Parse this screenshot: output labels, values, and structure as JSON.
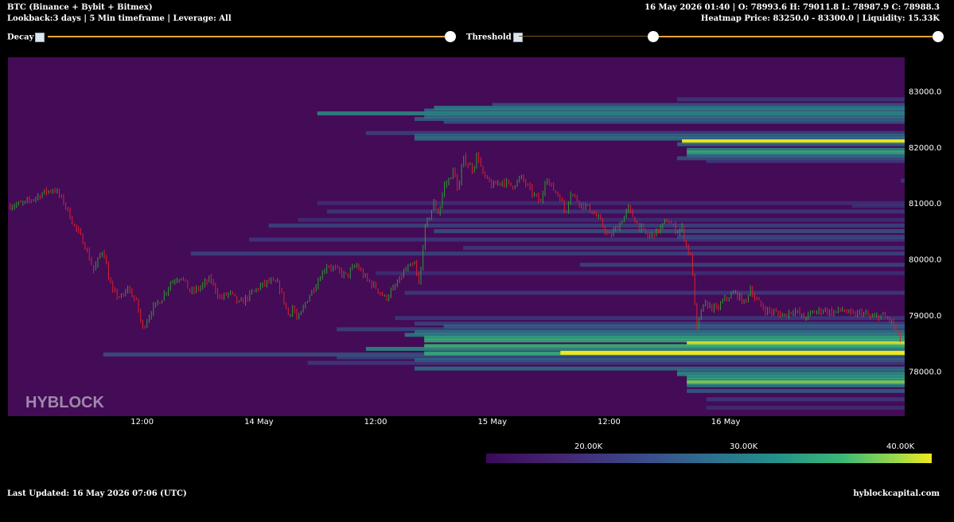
{
  "header": {
    "title": "BTC (Binance + Bybit + Bitmex)",
    "lookback": "Lookback:3 days | 5 Min timeframe | Leverage: All",
    "ohlc": "16 May 2026 01:40 | O: 78993.6 H: 79011.8 L: 78987.9 C: 78988.3",
    "heatmap_price": "Heatmap Price: 83250.0 - 83300.0 | Liquidity: 15.33K"
  },
  "controls": {
    "decay_label": "Decay",
    "threshold_label": "Threshold",
    "accent": "#e8a33d",
    "decay_value": 1.0,
    "threshold_range": [
      0.32,
      1.0
    ]
  },
  "footer": {
    "last_updated": "Last Updated: 16 May 2026 07:06 (UTC)",
    "site": "hyblockcapital.com"
  },
  "chart_data": {
    "type": "heatmap",
    "watermark": "HYBLOCK",
    "background": "#440b57",
    "y_ticks": [
      "83000.0",
      "82000.0",
      "81000.0",
      "80000.0",
      "79000.0",
      "78000.0"
    ],
    "ylim": [
      77200,
      83600
    ],
    "x_tick_labels": [
      "12:00",
      "14 May",
      "12:00",
      "15 May",
      "12:00",
      "16 May"
    ],
    "x_ticks_hours": [
      12,
      24,
      36,
      48,
      60,
      72
    ],
    "xlim_hours": [
      -1.8,
      90.4
    ],
    "colorbar": {
      "labels": [
        "20.00K",
        "30.00K",
        "40.00K"
      ],
      "colors": [
        "#3a0a5a",
        "#3b4a8a",
        "#24908a",
        "#3bb876",
        "#f0e81e"
      ]
    },
    "price_path": [
      [
        -1.8,
        80950
      ],
      [
        0,
        81000
      ],
      [
        2,
        81200
      ],
      [
        3,
        81250
      ],
      [
        4,
        81000
      ],
      [
        5,
        80600
      ],
      [
        6,
        80300
      ],
      [
        7,
        79800
      ],
      [
        8,
        80200
      ],
      [
        8.5,
        79700
      ],
      [
        9,
        79400
      ],
      [
        10,
        79300
      ],
      [
        10.5,
        79500
      ],
      [
        11.5,
        79200
      ],
      [
        12,
        78750
      ],
      [
        13,
        79100
      ],
      [
        14,
        79300
      ],
      [
        15,
        79600
      ],
      [
        16,
        79700
      ],
      [
        17,
        79400
      ],
      [
        18,
        79500
      ],
      [
        19,
        79650
      ],
      [
        20,
        79300
      ],
      [
        21,
        79400
      ],
      [
        22,
        79200
      ],
      [
        23,
        79350
      ],
      [
        24,
        79500
      ],
      [
        25,
        79600
      ],
      [
        26,
        79550
      ],
      [
        26.5,
        79300
      ],
      [
        27,
        79000
      ],
      [
        27.5,
        79150
      ],
      [
        28,
        78900
      ],
      [
        29,
        79300
      ],
      [
        30,
        79600
      ],
      [
        31,
        79900
      ],
      [
        32,
        79800
      ],
      [
        33,
        79700
      ],
      [
        34,
        79900
      ],
      [
        35,
        79650
      ],
      [
        36,
        79500
      ],
      [
        37,
        79300
      ],
      [
        38,
        79500
      ],
      [
        39,
        79800
      ],
      [
        40,
        79900
      ],
      [
        40.5,
        79500
      ],
      [
        41,
        80500
      ],
      [
        42,
        81000
      ],
      [
        42.5,
        80800
      ],
      [
        43,
        81300
      ],
      [
        43.5,
        81400
      ],
      [
        44,
        81600
      ],
      [
        44.5,
        81200
      ],
      [
        45,
        81800
      ],
      [
        46,
        81600
      ],
      [
        46.5,
        81900
      ],
      [
        47,
        81500
      ],
      [
        48,
        81300
      ],
      [
        49,
        81400
      ],
      [
        50,
        81300
      ],
      [
        51,
        81450
      ],
      [
        52,
        81200
      ],
      [
        53,
        81000
      ],
      [
        53.5,
        81500
      ],
      [
        54,
        81300
      ],
      [
        55,
        81100
      ],
      [
        55.5,
        80800
      ],
      [
        56,
        81200
      ],
      [
        57,
        81000
      ],
      [
        58,
        80900
      ],
      [
        59,
        80700
      ],
      [
        60,
        80400
      ],
      [
        61,
        80600
      ],
      [
        62,
        80900
      ],
      [
        63,
        80600
      ],
      [
        64,
        80400
      ],
      [
        65,
        80500
      ],
      [
        66,
        80700
      ],
      [
        67,
        80500
      ],
      [
        67.5,
        80550
      ],
      [
        68,
        80200
      ],
      [
        68.5,
        80000
      ],
      [
        69,
        78700
      ],
      [
        69.5,
        79100
      ],
      [
        70,
        79200
      ],
      [
        71,
        79100
      ],
      [
        72,
        79300
      ],
      [
        73,
        79400
      ],
      [
        74,
        79200
      ],
      [
        74.5,
        79500
      ],
      [
        75,
        79300
      ],
      [
        76,
        79100
      ],
      [
        77,
        79050
      ],
      [
        78,
        79000
      ],
      [
        79,
        79100
      ],
      [
        80,
        78950
      ],
      [
        81,
        79050
      ],
      [
        82,
        79100
      ],
      [
        83,
        79050
      ],
      [
        84,
        79100
      ],
      [
        85,
        79000
      ],
      [
        86,
        79050
      ],
      [
        87,
        78950
      ],
      [
        88,
        79000
      ],
      [
        89,
        78900
      ],
      [
        89.5,
        78700
      ],
      [
        90,
        78550
      ]
    ],
    "liquidity_bands": [
      [
        82600,
        30,
        90.4,
        0.55
      ],
      [
        82650,
        41,
        90.4,
        0.45
      ],
      [
        82700,
        42,
        90.4,
        0.5
      ],
      [
        82750,
        48,
        90.4,
        0.35
      ],
      [
        82850,
        67,
        90.4,
        0.25
      ],
      [
        82500,
        40,
        90.4,
        0.4
      ],
      [
        82550,
        41,
        90.4,
        0.45
      ],
      [
        82450,
        43,
        90.4,
        0.35
      ],
      [
        82250,
        35,
        90.4,
        0.3
      ],
      [
        82200,
        40,
        90.4,
        0.4
      ],
      [
        82150,
        40,
        90.4,
        0.45
      ],
      [
        82100,
        67.5,
        90.4,
        1.0
      ],
      [
        82050,
        67,
        90.4,
        0.4
      ],
      [
        81950,
        68,
        90.4,
        0.55
      ],
      [
        81900,
        68,
        90.4,
        0.7
      ],
      [
        81850,
        68,
        90.4,
        0.45
      ],
      [
        81800,
        67,
        90.4,
        0.35
      ],
      [
        81750,
        70,
        90.4,
        0.25
      ],
      [
        81400,
        90,
        90.4,
        0.25
      ],
      [
        81000,
        30,
        90.4,
        0.2
      ],
      [
        80950,
        85,
        90.4,
        0.2
      ],
      [
        80850,
        31,
        90.4,
        0.25
      ],
      [
        80600,
        25,
        90.4,
        0.3
      ],
      [
        80700,
        28,
        90.4,
        0.2
      ],
      [
        80500,
        42,
        90.4,
        0.35
      ],
      [
        80350,
        23,
        90.4,
        0.25
      ],
      [
        80400,
        67,
        90.4,
        0.3
      ],
      [
        80200,
        45,
        90.4,
        0.25
      ],
      [
        80100,
        17,
        90.4,
        0.3
      ],
      [
        79900,
        57,
        90.4,
        0.3
      ],
      [
        79750,
        36,
        90.4,
        0.2
      ],
      [
        79400,
        39,
        90.4,
        0.25
      ],
      [
        78950,
        38,
        90.4,
        0.25
      ],
      [
        78850,
        40,
        90.4,
        0.3
      ],
      [
        78800,
        43,
        90.4,
        0.4
      ],
      [
        78750,
        32,
        90.4,
        0.3
      ],
      [
        78700,
        40,
        90.4,
        0.45
      ],
      [
        78650,
        39,
        90.4,
        0.5
      ],
      [
        78600,
        41,
        90.4,
        0.65
      ],
      [
        78550,
        41,
        90.4,
        0.7
      ],
      [
        78500,
        68,
        90.4,
        0.95
      ],
      [
        78450,
        41,
        90.4,
        0.75
      ],
      [
        78400,
        35,
        90.4,
        0.55
      ],
      [
        78300,
        8,
        90.4,
        0.35
      ],
      [
        78320,
        41,
        90.4,
        0.7
      ],
      [
        78330,
        55,
        90.4,
        1.0
      ],
      [
        78250,
        32,
        90.4,
        0.3
      ],
      [
        78200,
        40,
        90.4,
        0.4
      ],
      [
        78150,
        29,
        90.4,
        0.25
      ],
      [
        78050,
        40,
        90.4,
        0.45
      ],
      [
        78000,
        67,
        90.4,
        0.4
      ],
      [
        77950,
        67,
        90.4,
        0.55
      ],
      [
        77900,
        68,
        90.4,
        0.6
      ],
      [
        77850,
        68,
        90.4,
        0.65
      ],
      [
        77800,
        68,
        90.4,
        0.85
      ],
      [
        77750,
        68,
        90.4,
        0.5
      ],
      [
        77650,
        68,
        90.4,
        0.4
      ],
      [
        77500,
        70,
        90.4,
        0.25
      ],
      [
        77350,
        70,
        90.4,
        0.2
      ]
    ]
  }
}
